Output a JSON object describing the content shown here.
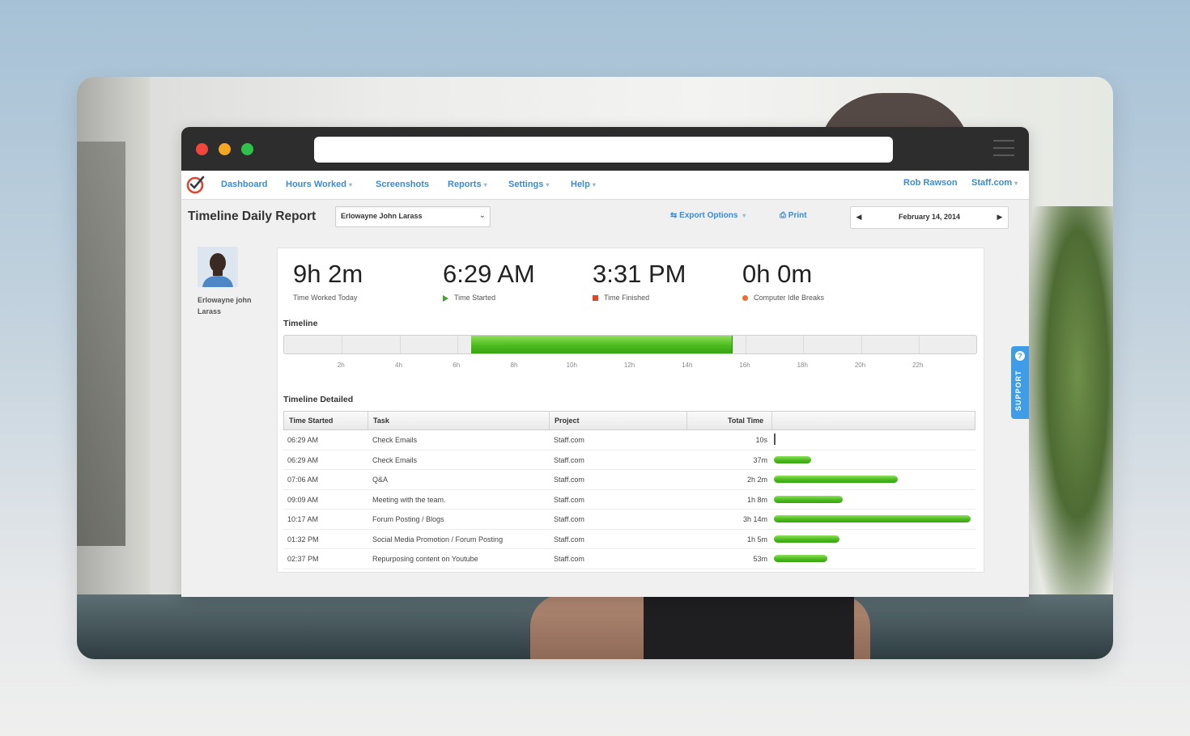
{
  "nav": {
    "items": [
      {
        "label": "Dashboard",
        "dropdown": false
      },
      {
        "label": "Hours Worked",
        "dropdown": true
      },
      {
        "label": "Screenshots",
        "dropdown": false
      },
      {
        "label": "Reports",
        "dropdown": true
      },
      {
        "label": "Settings",
        "dropdown": true
      },
      {
        "label": "Help",
        "dropdown": true
      }
    ],
    "user": "Rob Rawson",
    "company": "Staff.com"
  },
  "header": {
    "title": "Timeline Daily Report",
    "employee_selected": "Erlowayne John Larass",
    "export_label": "Export Options",
    "print_label": "Print",
    "date": "February 14, 2014"
  },
  "employee": {
    "name": "Erlowayne john Larass"
  },
  "stats": [
    {
      "value": "9h 2m",
      "label": "Time Worked Today",
      "marker": "none"
    },
    {
      "value": "6:29 AM",
      "label": "Time Started",
      "marker": "start"
    },
    {
      "value": "3:31 PM",
      "label": "Time Finished",
      "marker": "finish"
    },
    {
      "value": "0h 0m",
      "label": "Computer Idle Breaks",
      "marker": "idle"
    }
  ],
  "timeline": {
    "label": "Timeline",
    "ticks": [
      "2h",
      "4h",
      "6h",
      "8h",
      "10h",
      "12h",
      "14h",
      "16h",
      "18h",
      "20h",
      "22h"
    ],
    "range_hours": [
      0,
      24
    ],
    "segments": [
      {
        "start": 6.48,
        "end": 7.1
      },
      {
        "start": 7.1,
        "end": 9.15
      },
      {
        "start": 9.15,
        "end": 10.28
      },
      {
        "start": 10.28,
        "end": 13.53
      },
      {
        "start": 13.53,
        "end": 14.62
      },
      {
        "start": 14.62,
        "end": 15.52
      }
    ]
  },
  "detailed": {
    "label": "Timeline Detailed",
    "columns": [
      "Time Started",
      "Task",
      "Project",
      "Total Time"
    ],
    "rows": [
      {
        "start": "06:29 AM",
        "task": "Check Emails",
        "project": "Staff.com",
        "total": "10s",
        "minutes": 0.17
      },
      {
        "start": "06:29 AM",
        "task": "Check Emails",
        "project": "Staff.com",
        "total": "37m",
        "minutes": 37
      },
      {
        "start": "07:06 AM",
        "task": "Q&A",
        "project": "Staff.com",
        "total": "2h 2m",
        "minutes": 122
      },
      {
        "start": "09:09 AM",
        "task": "Meeting with the team.",
        "project": "Staff.com",
        "total": "1h 8m",
        "minutes": 68
      },
      {
        "start": "10:17 AM",
        "task": "Forum Posting / Blogs",
        "project": "Staff.com",
        "total": "3h 14m",
        "minutes": 194
      },
      {
        "start": "01:32 PM",
        "task": "Social Media Promotion / Forum Posting",
        "project": "Staff.com",
        "total": "1h 5m",
        "minutes": 65
      },
      {
        "start": "02:37 PM",
        "task": "Repurposing content on Youtube",
        "project": "Staff.com",
        "total": "53m",
        "minutes": 53
      }
    ]
  },
  "support": {
    "label": "SUPPORT"
  },
  "colors": {
    "link": "#3b8bd9",
    "bar_green": "#4cbb1f",
    "start_marker": "#3ea52a",
    "finish_marker": "#e3472b",
    "idle_marker": "#ef6b2f",
    "support_tab": "#3f9ce8"
  }
}
